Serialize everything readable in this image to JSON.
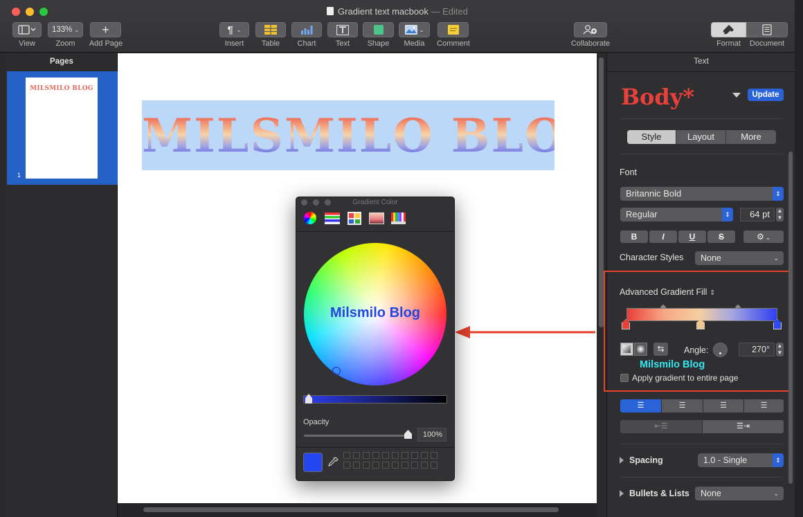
{
  "window": {
    "title": "Gradient text macbook",
    "edited": "— Edited"
  },
  "toolbar": {
    "view": "View",
    "zoom_value": "133%",
    "zoom": "Zoom",
    "add_page": "Add Page",
    "insert": "Insert",
    "table": "Table",
    "chart": "Chart",
    "text": "Text",
    "shape": "Shape",
    "media": "Media",
    "comment": "Comment",
    "collaborate": "Collaborate",
    "format": "Format",
    "document": "Document"
  },
  "sidebar": {
    "title": "Pages",
    "thumb_text": "MILSMILO BLOG",
    "page_number": "1"
  },
  "canvas": {
    "headline": "MILSMILO BLOG"
  },
  "color_panel": {
    "title": "Gradient Color",
    "overlay_text": "Milsmilo Blog",
    "opacity_label": "Opacity",
    "opacity_value": "100%",
    "current_color": "#2346f0"
  },
  "inspector": {
    "header": "Text",
    "style_name": "Body*",
    "update": "Update",
    "tabs": [
      "Style",
      "Layout",
      "More"
    ],
    "font_label": "Font",
    "font_family": "Britannic Bold",
    "font_style": "Regular",
    "font_size": "64 pt",
    "format_buttons": [
      "B",
      "I",
      "U",
      "S"
    ],
    "char_styles_label": "Character Styles",
    "char_styles_value": "None",
    "gradient_label": "Advanced Gradient Fill",
    "angle_label": "Angle:",
    "angle_value": "270°",
    "watermark": "Milsmilo Blog",
    "apply_gradient": "Apply gradient to entire page",
    "spacing_label": "Spacing",
    "spacing_value": "1.0 - Single",
    "bullets_label": "Bullets & Lists",
    "bullets_value": "None"
  },
  "colors": {
    "accent": "#2c63d9",
    "highlight_box": "#e8432f",
    "selection": "#bcd8f8"
  }
}
